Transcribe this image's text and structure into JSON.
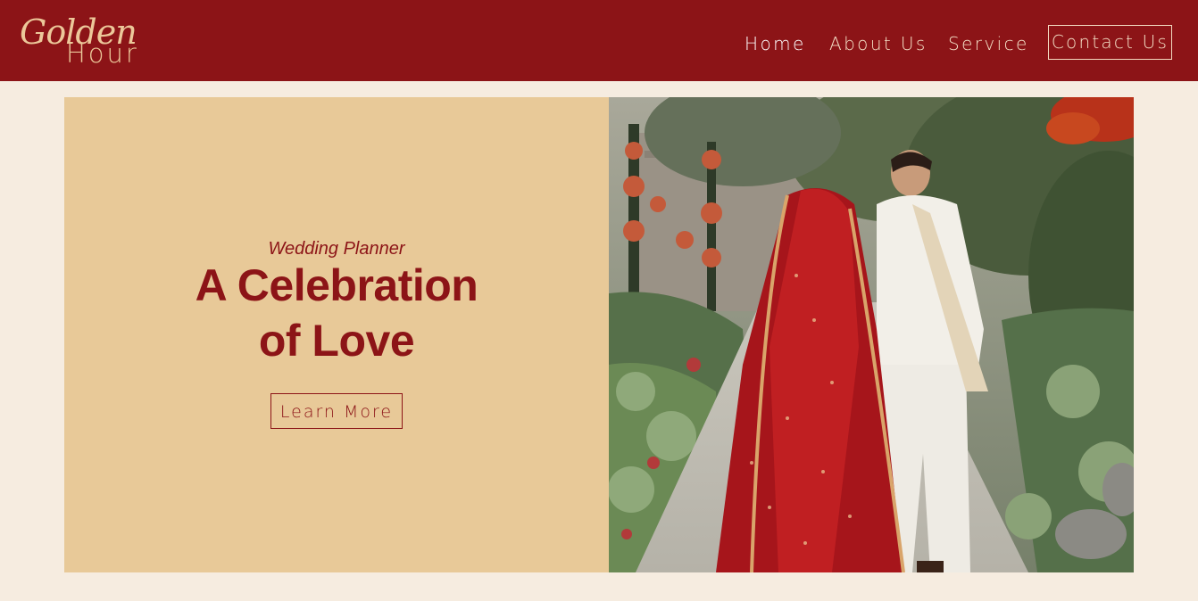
{
  "brand": {
    "script": "Golden",
    "word": "Hour"
  },
  "nav": {
    "home": "Home",
    "about": "About Us",
    "service": "Service",
    "contact": "Contact Us"
  },
  "hero": {
    "eyebrow": "Wedding Planner",
    "headline_line1": "A Celebration",
    "headline_line2": "of Love",
    "cta_label": "Learn More",
    "photo_subject": "wedding-couple-garden-photo"
  },
  "colors": {
    "brand_red": "#8c1417",
    "sand": "#e8c998",
    "cream": "#f6ece0",
    "gold": "#ecc89a"
  }
}
